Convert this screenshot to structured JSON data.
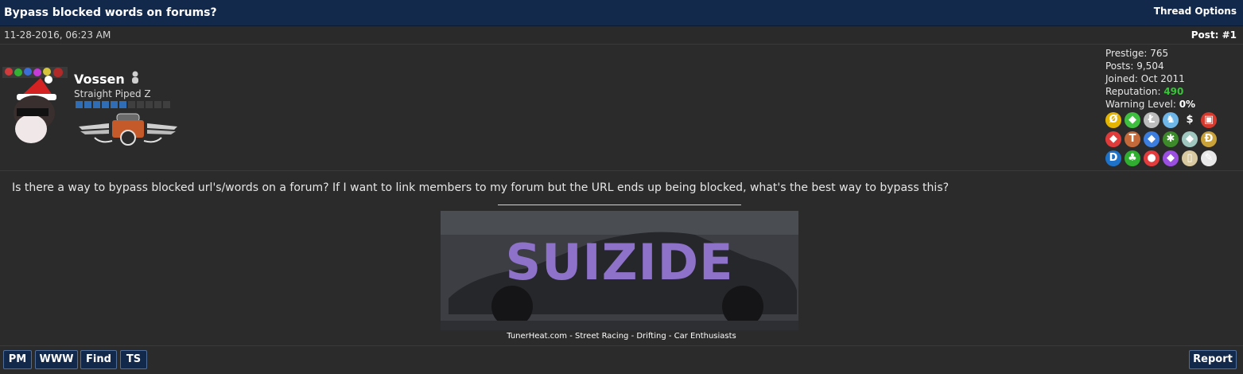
{
  "thread": {
    "title": "Bypass blocked words on forums?",
    "options_label": "Thread Options"
  },
  "post": {
    "date": "11-28-2016, 06:23 AM",
    "post_label": "Post:",
    "post_number": "#1"
  },
  "user": {
    "name": "Vossen",
    "status": "offline",
    "title": "Straight Piped Z",
    "rep_level": 6,
    "rep_total": 11,
    "prestige_label": "Prestige:",
    "prestige": "765",
    "posts_label": "Posts:",
    "posts": "9,504",
    "joined_label": "Joined:",
    "joined": "Oct 2011",
    "reputation_label": "Reputation:",
    "reputation": "490",
    "warning_label": "Warning Level:",
    "warning": "0%"
  },
  "awards": [
    {
      "icon": "zero-coin-icon",
      "color": "#e4b400",
      "glyph": "Ø"
    },
    {
      "icon": "green-gem-icon",
      "color": "#3fbf3f",
      "glyph": "◆"
    },
    {
      "icon": "litecoin-icon",
      "color": "#bdbdbd",
      "glyph": "Ł"
    },
    {
      "icon": "pony-icon",
      "color": "#6fb6e8",
      "glyph": "♞"
    },
    {
      "icon": "dollar-icon",
      "color": "#2b2b2b",
      "glyph": "$"
    },
    {
      "icon": "gift-icon",
      "color": "#d63a2f",
      "glyph": "▣"
    },
    {
      "icon": "red-gem-icon",
      "color": "#e03b3b",
      "glyph": "◆"
    },
    {
      "icon": "hammer-icon",
      "color": "#c46a3a",
      "glyph": "T"
    },
    {
      "icon": "blue-gem-icon",
      "color": "#3b7ee0",
      "glyph": "◆"
    },
    {
      "icon": "leaf-icon",
      "color": "#3d8a2a",
      "glyph": "✱"
    },
    {
      "icon": "ethereum-icon",
      "color": "#9fc7c0",
      "glyph": "◆"
    },
    {
      "icon": "dogecoin-icon",
      "color": "#c9a23a",
      "glyph": "Ð"
    },
    {
      "icon": "dash-coin-icon",
      "color": "#1e73c8",
      "glyph": "D"
    },
    {
      "icon": "clover-icon",
      "color": "#2fae2f",
      "glyph": "♣"
    },
    {
      "icon": "pokeball-icon",
      "color": "#e23c3c",
      "glyph": "●"
    },
    {
      "icon": "purple-gem-icon",
      "color": "#9b4fe0",
      "glyph": "◆"
    },
    {
      "icon": "beer-icon",
      "color": "#d8c9a0",
      "glyph": "▯"
    },
    {
      "icon": "notepad-icon",
      "color": "#e8e8e8",
      "glyph": "✎"
    }
  ],
  "content": {
    "message": "Is there a way to bypass blocked url's/words on a forum? If I want to link members to my forum but the URL ends up being blocked, what's the best way to bypass this?",
    "signature_banner_text": "SUIZIDE",
    "signature_text": "TunerHeat.com - Street Racing - Drifting - Car Enthusiasts"
  },
  "actions": {
    "pm": "PM",
    "www": "WWW",
    "find": "Find",
    "ts": "TS",
    "report": "Report"
  },
  "colors": {
    "header_bg": "#13294b",
    "page_bg": "#2b2b2b",
    "reputation_green": "#3bc33b",
    "rep_bar_filled": "#2f6db6",
    "banner_purple": "#8e71c9"
  }
}
